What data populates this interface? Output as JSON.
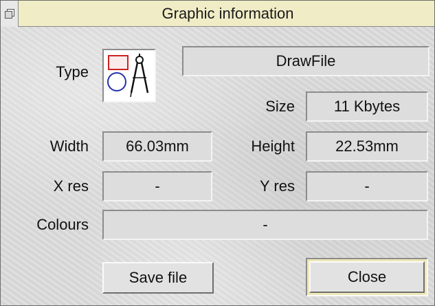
{
  "window": {
    "title": "Graphic information"
  },
  "type": {
    "label": "Type",
    "value": "DrawFile",
    "icon": "drawfile-icon"
  },
  "size": {
    "label": "Size",
    "value": "11 Kbytes"
  },
  "width": {
    "label": "Width",
    "value": "66.03mm"
  },
  "height": {
    "label": "Height",
    "value": "22.53mm"
  },
  "xres": {
    "label": "X res",
    "value": "-"
  },
  "yres": {
    "label": "Y res",
    "value": "-"
  },
  "colours": {
    "label": "Colours",
    "value": "-"
  },
  "buttons": {
    "save": "Save file",
    "close": "Close"
  },
  "colors": {
    "title_bar": "#f0ecc6",
    "window_bg": "#dcdcdc",
    "icon_red": "#cc2222",
    "icon_blue": "#2233aa"
  }
}
